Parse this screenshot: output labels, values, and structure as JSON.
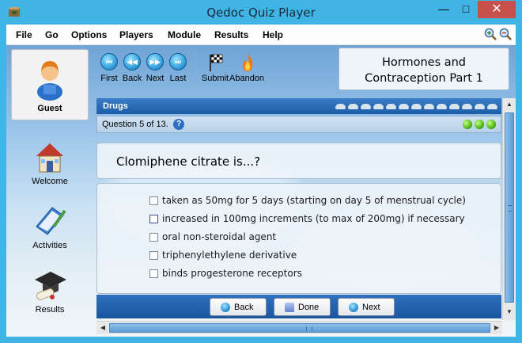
{
  "window": {
    "title": "Qedoc Quiz Player",
    "min_glyph": "—",
    "max_glyph": "□",
    "close_glyph": "✕"
  },
  "menu": [
    "File",
    "Go",
    "Options",
    "Players",
    "Module",
    "Results",
    "Help"
  ],
  "sidebar": {
    "user": "Guest",
    "items": [
      {
        "label": "Welcome",
        "icon": "house-icon"
      },
      {
        "label": "Activities",
        "icon": "book-pen-icon"
      },
      {
        "label": "Results",
        "icon": "graduation-cap-icon"
      }
    ]
  },
  "toolbar": {
    "nav": [
      {
        "label": "First",
        "glyph": "⏮"
      },
      {
        "label": "Back",
        "glyph": "◀◀"
      },
      {
        "label": "Next",
        "glyph": "▶▶"
      },
      {
        "label": "Last",
        "glyph": "⏭"
      }
    ],
    "submit": "Submit",
    "abandon": "Abandon"
  },
  "module_title": {
    "line1": "Hormones and",
    "line2": "Contraception Part 1"
  },
  "quiz": {
    "section": "Drugs",
    "question_info": "Question 5 of 13.",
    "help_glyph": "?",
    "question": "Clomiphene citrate is...?",
    "answers": [
      "taken as 50mg for 5 days (starting on day 5 of menstrual cycle)",
      "increased in 100mg increments (to max of 200mg) if necessary",
      "oral non-steroidal agent",
      "triphenylethylene derivative",
      "binds progesterone receptors"
    ],
    "focused_answer": 1,
    "buttons": {
      "back": "Back",
      "done": "Done",
      "next": "Next"
    }
  },
  "colors": {
    "titlebar": "#41b4e6",
    "close": "#c7504a",
    "section_bar": "#1d5da8"
  }
}
